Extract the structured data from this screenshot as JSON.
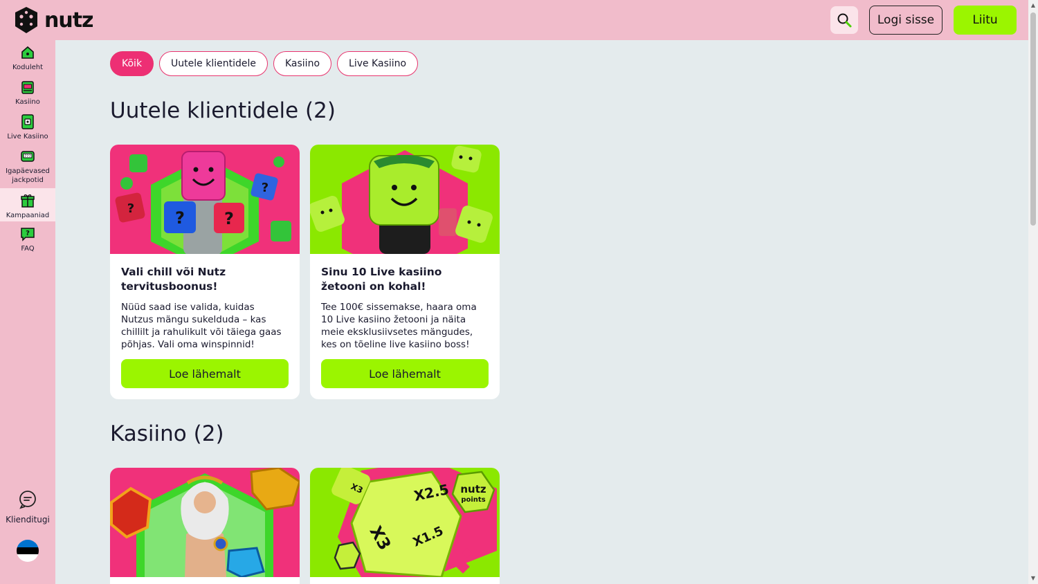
{
  "header": {
    "logo_text": "nutz",
    "login_label": "Logi sisse",
    "join_label": "Liitu"
  },
  "sidebar": {
    "items": [
      {
        "label": "Koduleht",
        "icon": "home-icon"
      },
      {
        "label": "Kasiino",
        "icon": "slot-machine-icon"
      },
      {
        "label": "Live Kasiino",
        "icon": "live-casino-icon"
      },
      {
        "label": "Igapäevased jackpotid",
        "icon": "jackpot-icon"
      },
      {
        "label": "Kampaaniad",
        "icon": "gift-icon",
        "active": true
      },
      {
        "label": "FAQ",
        "icon": "faq-icon"
      }
    ],
    "support_label": "Klienditugi"
  },
  "filters": [
    "Kõik",
    "Uutele klientidele",
    "Kasiino",
    "Live Kasiino"
  ],
  "sections": [
    {
      "title": "Uutele klientidele (2)",
      "cards": [
        {
          "title": "Vali chill või Nutz tervitusboonus!",
          "description": "Nüüd saad ise valida, kuidas Nutzus mängu sukelduda – kas chillilt ja rahulikult või täiega gaas põhjas. Vali oma winspinnid!",
          "button": "Loe lähemalt"
        },
        {
          "title": "Sinu 10 Live kasiino žetooni on kohal!",
          "description": "Tee 100€ sissemakse, haara oma 10 Live kasiino žetooni ja näita meie eksklusiivsetes mängudes, kes on tõeline live kasiino boss!",
          "button": "Loe lähemalt"
        }
      ]
    },
    {
      "title": "Kasiino (2)",
      "cards": [
        {
          "image_text": ""
        },
        {
          "image_text": "nutz points"
        }
      ]
    }
  ],
  "colors": {
    "brand_pink": "#f1bccb",
    "accent_pink": "#ed2f74",
    "accent_green": "#9bf500",
    "background": "#e4ebed"
  }
}
